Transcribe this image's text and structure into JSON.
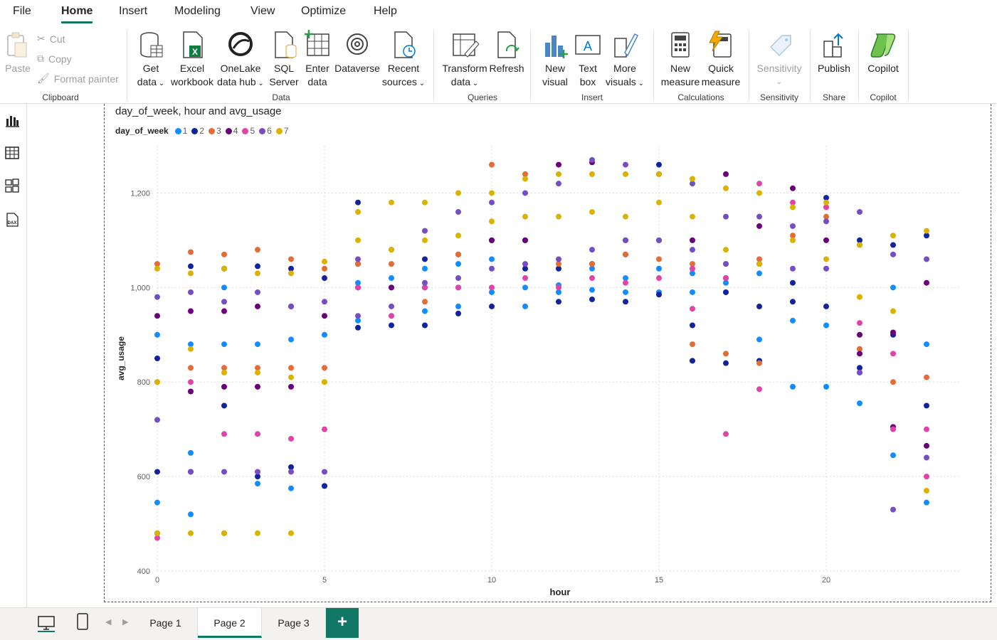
{
  "menu": {
    "tabs": [
      "File",
      "Home",
      "Insert",
      "Modeling",
      "View",
      "Optimize",
      "Help"
    ],
    "active": "Home"
  },
  "ribbon": {
    "clipboard": {
      "paste": "Paste",
      "cut": "Cut",
      "copy": "Copy",
      "format_painter": "Format painter",
      "label": "Clipboard"
    },
    "data": {
      "get_data": [
        "Get",
        "data"
      ],
      "excel": [
        "Excel",
        "workbook"
      ],
      "onelake": [
        "OneLake",
        "data hub"
      ],
      "sql": [
        "SQL",
        "Server"
      ],
      "enter": [
        "Enter",
        "data"
      ],
      "dataverse": "Dataverse",
      "recent": [
        "Recent",
        "sources"
      ],
      "label": "Data"
    },
    "queries": {
      "transform": [
        "Transform",
        "data"
      ],
      "refresh": "Refresh",
      "label": "Queries"
    },
    "insert": {
      "new_visual": [
        "New",
        "visual"
      ],
      "text_box": [
        "Text",
        "box"
      ],
      "more_visuals": [
        "More",
        "visuals"
      ],
      "label": "Insert"
    },
    "calculations": {
      "new_measure": [
        "New",
        "measure"
      ],
      "quick_measure": [
        "Quick",
        "measure"
      ],
      "label": "Calculations"
    },
    "sensitivity": {
      "btn": "Sensitivity",
      "label": "Sensitivity"
    },
    "share": {
      "publish": "Publish",
      "label": "Share"
    },
    "copilot": {
      "btn": "Copilot",
      "label": "Copilot"
    }
  },
  "rail": {
    "icons": [
      "report-view-icon",
      "table-view-icon",
      "model-view-icon",
      "dax-query-icon"
    ]
  },
  "pages": {
    "tabs": [
      "Page 1",
      "Page 2",
      "Page 3"
    ],
    "active": "Page 2",
    "add": "+"
  },
  "colors": {
    "accent": "#117865"
  },
  "chart_data": {
    "type": "scatter",
    "title": "day_of_week, hour and avg_usage",
    "xlabel": "hour",
    "ylabel": "avg_usage",
    "xlim": [
      0,
      24
    ],
    "ylim": [
      400,
      1300
    ],
    "xticks": [
      0,
      5,
      10,
      15,
      20
    ],
    "yticks": [
      400,
      600,
      800,
      1000,
      1200
    ],
    "ytick_labels": [
      "400",
      "600",
      "800",
      "1,000",
      "1,200"
    ],
    "grid": true,
    "legend": {
      "title": "day_of_week",
      "placement": "top-left"
    },
    "series": [
      {
        "name": "1",
        "color": "#118DFF",
        "x": [
          0,
          0,
          1,
          1,
          1,
          2,
          2,
          3,
          3,
          4,
          4,
          5,
          5,
          6,
          6,
          7,
          7,
          8,
          8,
          9,
          9,
          10,
          10,
          11,
          11,
          12,
          12,
          13,
          13,
          14,
          14,
          15,
          15,
          16,
          16,
          17,
          17,
          18,
          18,
          19,
          19,
          20,
          20,
          21,
          21,
          22,
          22,
          23,
          23
        ],
        "y": [
          545,
          900,
          520,
          650,
          880,
          880,
          1000,
          585,
          880,
          575,
          890,
          580,
          900,
          930,
          1010,
          940,
          1020,
          950,
          1040,
          960,
          1050,
          990,
          1060,
          960,
          1000,
          990,
          1005,
          995,
          1040,
          990,
          1020,
          990,
          1040,
          990,
          1030,
          990,
          1010,
          890,
          1030,
          790,
          930,
          790,
          920,
          755,
          1090,
          645,
          1000,
          545,
          880
        ]
      },
      {
        "name": "2",
        "color": "#12239E",
        "x": [
          0,
          0,
          1,
          1,
          2,
          2,
          3,
          3,
          4,
          4,
          5,
          5,
          6,
          6,
          6,
          7,
          7,
          8,
          8,
          9,
          9,
          10,
          10,
          11,
          11,
          12,
          12,
          13,
          13,
          14,
          14,
          15,
          15,
          16,
          16,
          17,
          17,
          18,
          18,
          19,
          19,
          20,
          20,
          21,
          21,
          22,
          22,
          23,
          23
        ],
        "y": [
          850,
          610,
          1045,
          610,
          1040,
          750,
          1045,
          600,
          1040,
          620,
          1020,
          580,
          1180,
          1050,
          915,
          1000,
          920,
          920,
          1060,
          945,
          1070,
          960,
          1100,
          1040,
          1100,
          970,
          1040,
          975,
          1050,
          970,
          1070,
          1260,
          985,
          845,
          920,
          990,
          840,
          960,
          845,
          1010,
          970,
          1190,
          960,
          1100,
          830,
          1090,
          900,
          1110,
          750
        ]
      },
      {
        "name": "3",
        "color": "#E66C37",
        "x": [
          0,
          1,
          1,
          2,
          2,
          3,
          3,
          4,
          4,
          5,
          5,
          6,
          7,
          8,
          9,
          10,
          11,
          12,
          13,
          14,
          15,
          16,
          16,
          17,
          17,
          18,
          18,
          19,
          20,
          21,
          22,
          23
        ],
        "y": [
          1050,
          1075,
          830,
          1070,
          830,
          1080,
          830,
          1060,
          830,
          1040,
          830,
          1050,
          1050,
          970,
          1070,
          1260,
          1240,
          1050,
          1050,
          1070,
          1060,
          880,
          1050,
          860,
          1050,
          840,
          1060,
          1110,
          1150,
          870,
          800,
          810
        ]
      },
      {
        "name": "4",
        "color": "#6B007B",
        "x": [
          0,
          0,
          1,
          1,
          2,
          2,
          3,
          3,
          4,
          4,
          5,
          6,
          7,
          8,
          9,
          10,
          11,
          12,
          13,
          14,
          15,
          16,
          17,
          17,
          18,
          19,
          20,
          21,
          21,
          22,
          22,
          23,
          23
        ],
        "y": [
          940,
          480,
          950,
          780,
          950,
          790,
          960,
          790,
          960,
          790,
          940,
          1000,
          1000,
          1000,
          1000,
          1100,
          1100,
          1260,
          1265,
          1100,
          1100,
          1100,
          1240,
          1020,
          1130,
          1210,
          1100,
          900,
          860,
          905,
          705,
          1010,
          665
        ]
      },
      {
        "name": "5",
        "color": "#E044A7",
        "x": [
          0,
          0,
          1,
          2,
          2,
          3,
          4,
          5,
          6,
          7,
          8,
          9,
          10,
          11,
          12,
          13,
          14,
          15,
          16,
          16,
          17,
          17,
          18,
          18,
          19,
          20,
          21,
          21,
          22,
          22,
          23,
          23
        ],
        "y": [
          800,
          470,
          800,
          690,
          480,
          690,
          680,
          700,
          1000,
          940,
          1000,
          1000,
          1000,
          1020,
          1000,
          1020,
          1010,
          1020,
          955,
          1040,
          690,
          1020,
          785,
          1220,
          1180,
          1170,
          925,
          820,
          700,
          860,
          700,
          600
        ]
      },
      {
        "name": "6",
        "color": "#744EC2",
        "x": [
          0,
          0,
          1,
          1,
          2,
          2,
          3,
          3,
          4,
          4,
          5,
          5,
          6,
          6,
          7,
          7,
          8,
          8,
          9,
          9,
          10,
          10,
          11,
          11,
          12,
          12,
          13,
          13,
          14,
          14,
          15,
          15,
          16,
          16,
          17,
          17,
          18,
          18,
          19,
          19,
          20,
          20,
          21,
          21,
          22,
          22,
          23,
          23
        ],
        "y": [
          980,
          720,
          990,
          610,
          970,
          610,
          990,
          610,
          960,
          610,
          970,
          610,
          1060,
          940,
          1080,
          960,
          1120,
          1010,
          1160,
          1020,
          1180,
          1040,
          1200,
          1050,
          1220,
          1060,
          1270,
          1080,
          1260,
          1100,
          1240,
          1100,
          1220,
          1080,
          1150,
          1050,
          1150,
          1050,
          1130,
          1040,
          1140,
          1040,
          1160,
          820,
          1070,
          530,
          1060,
          640
        ]
      },
      {
        "name": "7",
        "color": "#D9B300",
        "x": [
          0,
          0,
          0,
          1,
          1,
          1,
          2,
          2,
          2,
          3,
          3,
          3,
          4,
          4,
          4,
          5,
          5,
          5,
          6,
          6,
          7,
          7,
          8,
          8,
          9,
          9,
          10,
          10,
          11,
          11,
          12,
          12,
          13,
          13,
          14,
          14,
          15,
          15,
          16,
          16,
          17,
          17,
          18,
          18,
          19,
          19,
          20,
          20,
          21,
          21,
          22,
          22,
          23,
          23
        ],
        "y": [
          1040,
          800,
          480,
          1030,
          870,
          480,
          1040,
          820,
          480,
          1030,
          820,
          480,
          1030,
          810,
          480,
          1055,
          800,
          800,
          1160,
          1100,
          1180,
          1080,
          1180,
          1100,
          1200,
          1110,
          1200,
          1140,
          1230,
          1150,
          1240,
          1150,
          1240,
          1160,
          1240,
          1150,
          1240,
          1180,
          1230,
          1150,
          1210,
          1080,
          1200,
          1050,
          1170,
          1100,
          1180,
          1060,
          1090,
          980,
          1110,
          950,
          1120,
          570
        ]
      }
    ]
  }
}
